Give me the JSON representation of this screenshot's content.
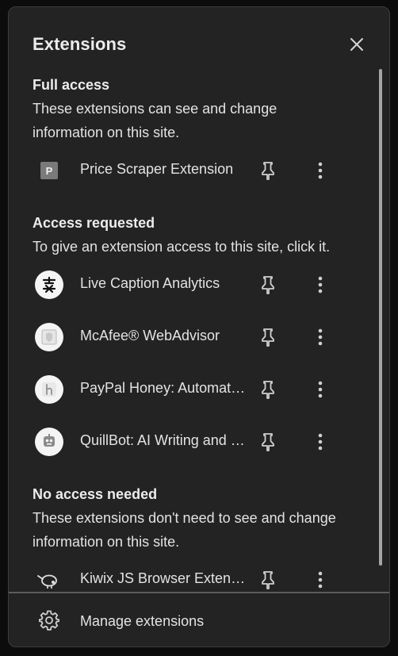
{
  "popup": {
    "title": "Extensions",
    "close_icon": "close-icon"
  },
  "full_access": {
    "heading": "Full access",
    "description": "These extensions can see and change information on this site.",
    "items": [
      {
        "name": "Price Scraper Extension",
        "icon": "P"
      }
    ]
  },
  "access_requested": {
    "heading": "Access requested",
    "description": "To give an extension access to this site, click it.",
    "items": [
      {
        "name": "Live Caption Analytics",
        "icon": "live-caption-icon"
      },
      {
        "name": "McAfee® WebAdvisor",
        "icon": "mcafee-shield-icon"
      },
      {
        "name": "PayPal Honey: Automatic Coupons & Rewards",
        "icon": "honey-h-icon"
      },
      {
        "name": "QuillBot: AI Writing and Grammar Checker Tool",
        "icon": "quillbot-robot-icon"
      }
    ]
  },
  "no_access_needed": {
    "heading": "No access needed",
    "description": "These extensions don't need to see and change information on this site.",
    "items": [
      {
        "name": "Kiwix JS Browser Extension",
        "icon": "kiwi-bird-icon"
      }
    ]
  },
  "footer": {
    "manage_label": "Manage extensions",
    "manage_icon": "gear-icon"
  },
  "colors": {
    "background": "#232323",
    "text": "#e3e3e3",
    "divider": "#5c5c5c"
  }
}
